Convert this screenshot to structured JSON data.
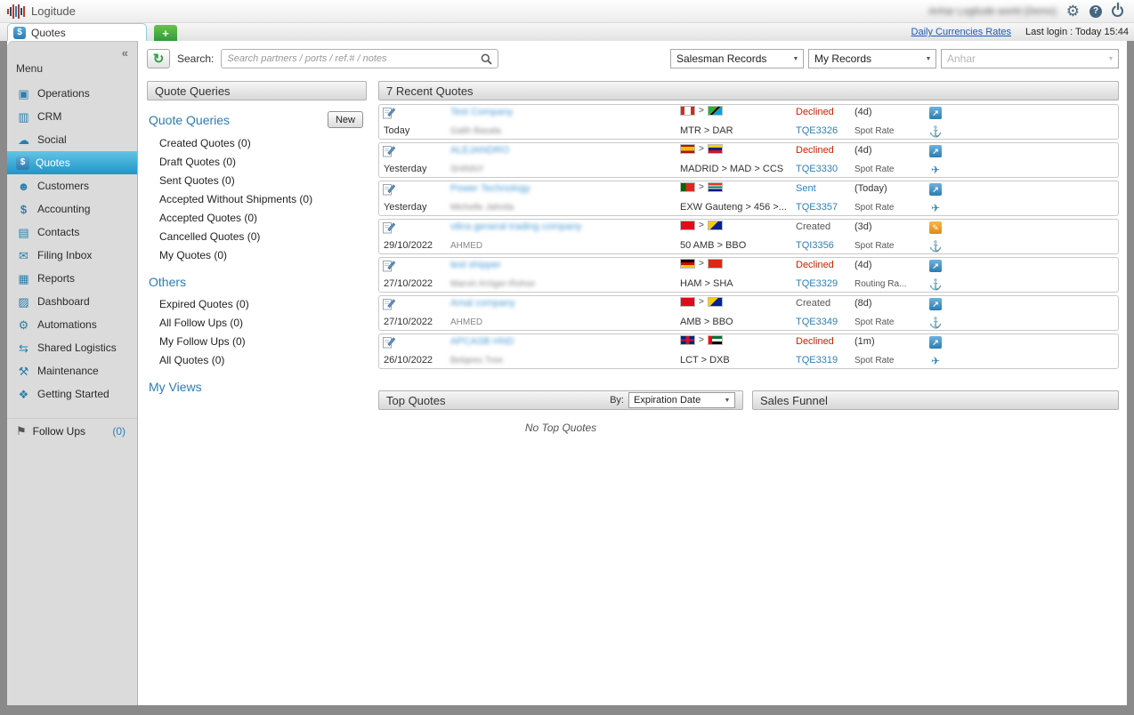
{
  "colors": {
    "accent": "#1f95c8",
    "declined": "#cc2200",
    "link": "#2f7fb5",
    "sent": "#2f7fb5"
  },
  "header": {
    "logo_text": "Logitude",
    "user_name": "Anhar  Logitude world (Demo)",
    "currencies_link": "Daily Currencies Rates",
    "last_login": "Last login : Today 15:44"
  },
  "tab_bar": {
    "active_tab": "Quotes",
    "new_tab_label": "+"
  },
  "sidebar": {
    "collapse_glyph": "«",
    "menu_title": "Menu",
    "items": [
      {
        "label": "Operations",
        "icon": "operations-icon",
        "active": false
      },
      {
        "label": "CRM",
        "icon": "crm-icon",
        "active": false
      },
      {
        "label": "Social",
        "icon": "social-icon",
        "active": false
      },
      {
        "label": "Quotes",
        "icon": "quotes-icon",
        "active": true
      },
      {
        "label": "Customers",
        "icon": "customers-icon",
        "active": false
      },
      {
        "label": "Accounting",
        "icon": "accounting-icon",
        "active": false
      },
      {
        "label": "Contacts",
        "icon": "contacts-icon",
        "active": false
      },
      {
        "label": "Filing Inbox",
        "icon": "filing-inbox-icon",
        "active": false
      },
      {
        "label": "Reports",
        "icon": "reports-icon",
        "active": false
      },
      {
        "label": "Dashboard",
        "icon": "dashboard-icon",
        "active": false
      },
      {
        "label": "Automations",
        "icon": "automations-icon",
        "active": false
      },
      {
        "label": "Shared Logistics",
        "icon": "shared-logistics-icon",
        "active": false
      },
      {
        "label": "Maintenance",
        "icon": "maintenance-icon",
        "active": false
      },
      {
        "label": "Getting Started",
        "icon": "getting-started-icon",
        "active": false
      }
    ],
    "follow_ups": {
      "label": "Follow Ups",
      "count": "(0)"
    }
  },
  "toolbar": {
    "search_label": "Search:",
    "search_placeholder": "Search partners / ports / ref.# / notes",
    "salesman_filter": "Salesman Records",
    "records_filter": "My Records",
    "user_filter": "Anhar"
  },
  "quote_queries": {
    "panel_title": "Quote Queries",
    "section1": {
      "title": "Quote Queries",
      "new_button": "New",
      "items": [
        "Created Quotes (0)",
        "Draft Quotes (0)",
        "Sent Quotes (0)",
        "Accepted Without Shipments (0)",
        "Accepted Quotes (0)",
        "Cancelled Quotes (0)",
        "My Quotes (0)"
      ]
    },
    "section2": {
      "title": "Others",
      "items": [
        "Expired Quotes (0)",
        "All Follow Ups (0)",
        "My Follow Ups (0)",
        "All Quotes (0)"
      ]
    },
    "section3": {
      "title": "My Views"
    }
  },
  "recent_quotes": {
    "panel_title": "7 Recent Quotes",
    "rows": [
      {
        "date": "Today",
        "company": "Test Company",
        "company_blurred": true,
        "contact": "Galih Basala",
        "contact_blurred": true,
        "origin_country": "CA",
        "dest_country": "TZ",
        "route": "MTR > DAR",
        "status": "Declined",
        "status_class": "declined",
        "ref": "TQE3326",
        "age": "(4d)",
        "rate_type": "Spot Rate",
        "action": "open",
        "mode": "sea"
      },
      {
        "date": "Yesterday",
        "company": "ALEJANDRO",
        "company_blurred": true,
        "contact": "SHINNY",
        "contact_blurred": true,
        "origin_country": "ES",
        "dest_country": "VE",
        "route": "MADRID > MAD > CCS",
        "status": "Declined",
        "status_class": "declined",
        "ref": "TQE3330",
        "age": "(4d)",
        "rate_type": "Spot Rate",
        "action": "open",
        "mode": "air"
      },
      {
        "date": "Yesterday",
        "company": "Power Technology",
        "company_blurred": true,
        "contact": "Michelle Jahnila",
        "contact_blurred": true,
        "origin_country": "PT",
        "dest_country": "ZA",
        "route": "EXW Gauteng > 456 >...",
        "status": "Sent",
        "status_class": "sent",
        "ref": "TQE3357",
        "age": "(Today)",
        "rate_type": "Spot Rate",
        "action": "open",
        "mode": "air"
      },
      {
        "date": "29/10/2022",
        "company": "vikra general trading company",
        "company_blurred": true,
        "contact": "AHMED",
        "contact_blurred": false,
        "origin_country": "TR",
        "dest_country": "BA",
        "route": "50 AMB > BBO",
        "status": "Created",
        "status_class": "created",
        "ref": "TQI3356",
        "age": "(3d)",
        "rate_type": "Spot Rate",
        "action": "edit",
        "mode": "sea"
      },
      {
        "date": "27/10/2022",
        "company": "test shipper",
        "company_blurred": true,
        "contact": "Marvin Kröger-Rohse",
        "contact_blurred": true,
        "origin_country": "DE",
        "dest_country": "CN",
        "route": "HAM > SHA",
        "status": "Declined",
        "status_class": "declined",
        "ref": "TQE3329",
        "age": "(4d)",
        "rate_type": "Routing Ra...",
        "action": "open",
        "mode": "sea"
      },
      {
        "date": "27/10/2022",
        "company": "Amal company",
        "company_blurred": true,
        "contact": "AHMED",
        "contact_blurred": false,
        "origin_country": "TR",
        "dest_country": "BA",
        "route": "AMB > BBO",
        "status": "Created",
        "status_class": "created",
        "ref": "TQE3349",
        "age": "(8d)",
        "rate_type": "Spot Rate",
        "action": "open",
        "mode": "sea"
      },
      {
        "date": "26/10/2022",
        "company": "APCASB HND",
        "company_blurred": true,
        "contact": "Belqees Tree",
        "contact_blurred": true,
        "origin_country": "GB",
        "dest_country": "AE",
        "route": "LCT > DXB",
        "status": "Declined",
        "status_class": "declined",
        "ref": "TQE3319",
        "age": "(1m)",
        "rate_type": "Spot Rate",
        "action": "open",
        "mode": "air"
      }
    ]
  },
  "top_quotes": {
    "panel_title": "Top Quotes",
    "by_label": "By:",
    "sort_value": "Expiration Date",
    "empty_text": "No Top Quotes"
  },
  "sales_funnel": {
    "panel_title": "Sales Funnel"
  }
}
